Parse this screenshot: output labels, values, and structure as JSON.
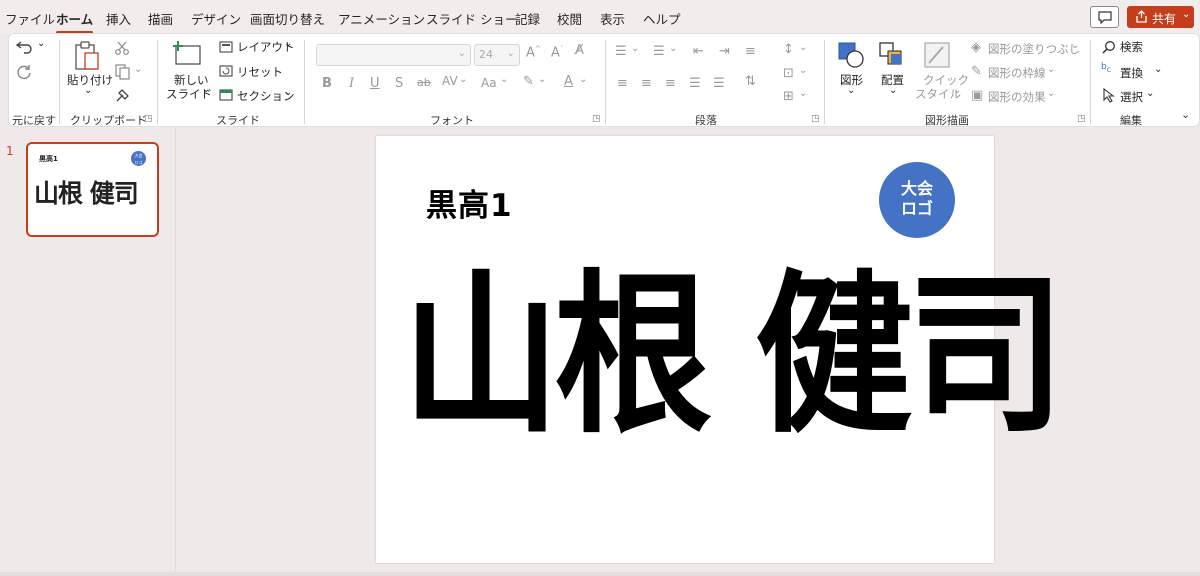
{
  "menu": {
    "tabs": [
      "ファイル",
      "ホーム",
      "挿入",
      "描画",
      "デザイン",
      "画面切り替え",
      "アニメーション",
      "スライド ショー",
      "記録",
      "校閲",
      "表示",
      "ヘルプ"
    ],
    "active": "ホーム",
    "share_label": "共有"
  },
  "ribbon": {
    "undo": {
      "label": "元に戻す"
    },
    "clipboard": {
      "label": "クリップボード",
      "paste_label": "貼り付け"
    },
    "slides": {
      "label": "スライド",
      "new_slide_line1": "新しい",
      "new_slide_line2": "スライド",
      "layout": "レイアウト",
      "reset": "リセット",
      "section": "セクション"
    },
    "font": {
      "label": "フォント",
      "size": "24"
    },
    "paragraph": {
      "label": "段落"
    },
    "drawing": {
      "label": "図形描画",
      "shapes": "図形",
      "arrange": "配置",
      "quick_styles_line1": "クイック",
      "quick_styles_line2": "スタイル",
      "shape_fill": "図形の塗りつぶし",
      "shape_outline": "図形の枠線",
      "shape_effects": "図形の効果"
    },
    "editing": {
      "label": "編集",
      "find": "検索",
      "replace": "置換",
      "select": "選択"
    }
  },
  "thumbnails": [
    {
      "number": "1",
      "subtitle": "黒高1",
      "logo_line1": "大会",
      "logo_line2": "ロゴ",
      "name": "山根 健司"
    }
  ],
  "slide": {
    "subtitle": "黒高1",
    "logo_line1": "大会",
    "logo_line2": "ロゴ",
    "name": "山根 健司"
  },
  "colors": {
    "accent": "#c43e1c",
    "logo": "#4472c4"
  }
}
